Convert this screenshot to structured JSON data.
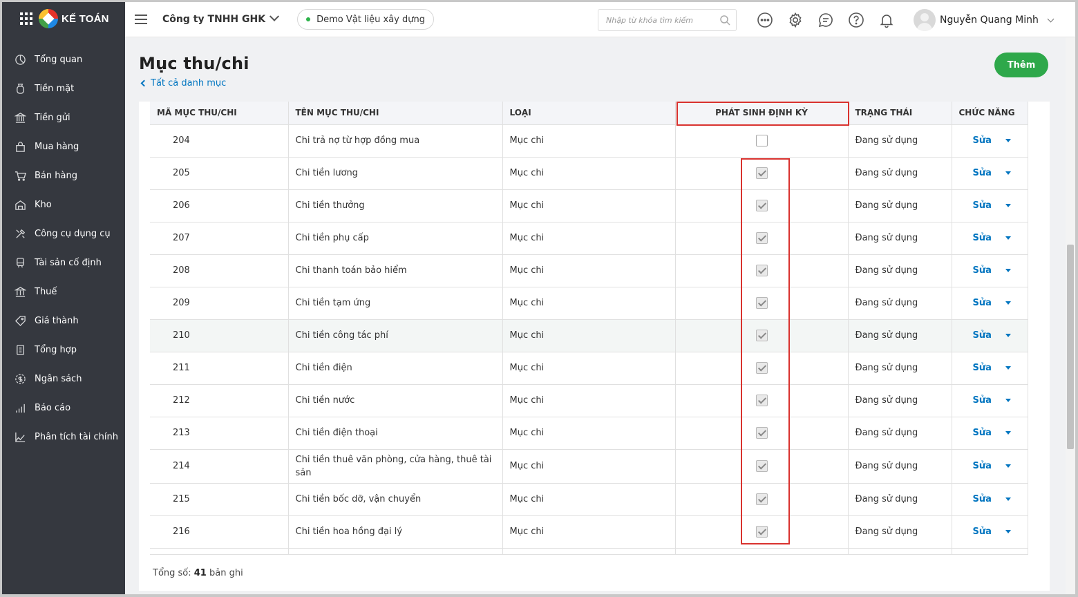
{
  "app": {
    "brand": "KẾ TOÁN"
  },
  "sidebar": {
    "items": [
      {
        "label": "Tổng quan",
        "icon": "dashboard-icon"
      },
      {
        "label": "Tiền mặt",
        "icon": "cash-icon"
      },
      {
        "label": "Tiền gửi",
        "icon": "bank-icon"
      },
      {
        "label": "Mua hàng",
        "icon": "shopping-bag-icon"
      },
      {
        "label": "Bán hàng",
        "icon": "cart-icon"
      },
      {
        "label": "Kho",
        "icon": "warehouse-icon"
      },
      {
        "label": "Công cụ dụng cụ",
        "icon": "tools-icon"
      },
      {
        "label": "Tài sản cố định",
        "icon": "asset-icon"
      },
      {
        "label": "Thuế",
        "icon": "tax-icon"
      },
      {
        "label": "Giá thành",
        "icon": "price-tag-icon"
      },
      {
        "label": "Tổng hợp",
        "icon": "document-icon"
      },
      {
        "label": "Ngân sách",
        "icon": "budget-icon"
      },
      {
        "label": "Báo cáo",
        "icon": "bar-chart-icon"
      },
      {
        "label": "Phân tích tài chính",
        "icon": "line-chart-icon"
      }
    ]
  },
  "header": {
    "company": "Công ty TNHH GHK",
    "demo_label": "Demo Vật liệu xây dựng",
    "search_placeholder": "Nhập từ khóa tìm kiếm",
    "user_name": "Nguyễn Quang Minh"
  },
  "page": {
    "title": "Mục thu/chi",
    "back_link": "Tất cả danh mục",
    "add_button": "Thêm",
    "total_label": "Tổng số:",
    "total_count": "41",
    "total_suffix": "bản ghi"
  },
  "table": {
    "headers": {
      "code": "MÃ MỤC THU/CHI",
      "name": "TÊN MỤC THU/CHI",
      "type": "LOẠI",
      "recurring": "PHÁT SINH ĐỊNH KỲ",
      "status": "TRẠNG THÁI",
      "actions": "CHỨC NĂNG"
    },
    "edit_label": "Sửa",
    "rows": [
      {
        "code": "204",
        "name": "Chi trả nợ từ hợp đồng mua",
        "type": "Mục chi",
        "recurring": false,
        "status": "Đang sử dụng"
      },
      {
        "code": "205",
        "name": "Chi tiền lương",
        "type": "Mục chi",
        "recurring": true,
        "status": "Đang sử dụng"
      },
      {
        "code": "206",
        "name": "Chi tiền thưởng",
        "type": "Mục chi",
        "recurring": true,
        "status": "Đang sử dụng"
      },
      {
        "code": "207",
        "name": "Chi tiền phụ cấp",
        "type": "Mục chi",
        "recurring": true,
        "status": "Đang sử dụng"
      },
      {
        "code": "208",
        "name": "Chi thanh toán bảo hiểm",
        "type": "Mục chi",
        "recurring": true,
        "status": "Đang sử dụng"
      },
      {
        "code": "209",
        "name": "Chi tiền tạm ứng",
        "type": "Mục chi",
        "recurring": true,
        "status": "Đang sử dụng"
      },
      {
        "code": "210",
        "name": "Chi tiền công tác phí",
        "type": "Mục chi",
        "recurring": true,
        "status": "Đang sử dụng",
        "highlighted": true
      },
      {
        "code": "211",
        "name": "Chi tiền điện",
        "type": "Mục chi",
        "recurring": true,
        "status": "Đang sử dụng"
      },
      {
        "code": "212",
        "name": "Chi tiền nước",
        "type": "Mục chi",
        "recurring": true,
        "status": "Đang sử dụng"
      },
      {
        "code": "213",
        "name": "Chi tiền điện thoại",
        "type": "Mục chi",
        "recurring": true,
        "status": "Đang sử dụng"
      },
      {
        "code": "214",
        "name": "Chi tiền thuê văn phòng, cửa hàng, thuê tài sản",
        "type": "Mục chi",
        "recurring": true,
        "status": "Đang sử dụng"
      },
      {
        "code": "215",
        "name": "Chi tiền bốc dỡ, vận chuyển",
        "type": "Mục chi",
        "recurring": true,
        "status": "Đang sử dụng"
      },
      {
        "code": "216",
        "name": "Chi tiền hoa hồng đại lý",
        "type": "Mục chi",
        "recurring": true,
        "status": "Đang sử dụng"
      }
    ]
  },
  "colors": {
    "sidebar_bg": "#35383f",
    "accent_green": "#2ea84a",
    "link_blue": "#0075c0",
    "highlight_red": "#d9322e"
  }
}
